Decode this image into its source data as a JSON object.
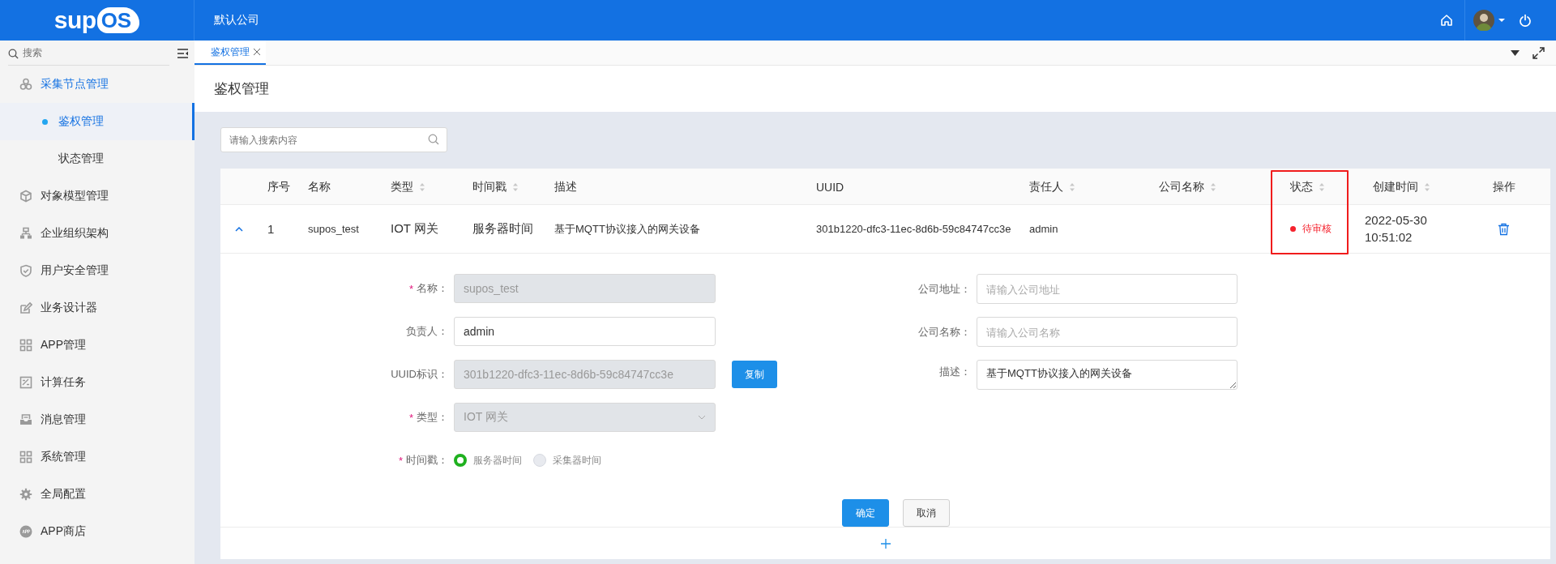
{
  "header": {
    "logo_text": "sup",
    "logo_badge": "OS",
    "company": "默认公司"
  },
  "sidebar": {
    "search_placeholder": "搜索",
    "items": [
      {
        "label": "采集节点管理",
        "selected": false,
        "expanded": true,
        "children": [
          {
            "label": "鉴权管理",
            "selected": true
          },
          {
            "label": "状态管理",
            "selected": false
          }
        ]
      },
      {
        "label": "对象模型管理",
        "selected": false,
        "expanded": false
      },
      {
        "label": "企业组织架构",
        "selected": false,
        "expanded": false
      },
      {
        "label": "用户安全管理",
        "selected": false,
        "expanded": false
      },
      {
        "label": "业务设计器",
        "selected": false,
        "expanded": false
      },
      {
        "label": "APP管理",
        "selected": false,
        "expanded": false
      },
      {
        "label": "计算任务",
        "selected": false,
        "expanded": false
      },
      {
        "label": "消息管理",
        "selected": false,
        "expanded": false
      },
      {
        "label": "系统管理",
        "selected": false,
        "expanded": false
      },
      {
        "label": "全局配置",
        "selected": false,
        "expanded": false
      },
      {
        "label": "APP商店",
        "selected": false,
        "expanded": false
      }
    ]
  },
  "tabs": [
    {
      "label": "鉴权管理",
      "selected": true
    }
  ],
  "page_title": "鉴权管理",
  "search": {
    "placeholder": "请输入搜索内容"
  },
  "table": {
    "columns": [
      {
        "label": "序号",
        "sortable": false,
        "highlighted": false
      },
      {
        "label": "名称",
        "sortable": false,
        "highlighted": false
      },
      {
        "label": "类型",
        "sortable": true,
        "highlighted": false
      },
      {
        "label": "时间戳",
        "sortable": true,
        "highlighted": false
      },
      {
        "label": "描述",
        "sortable": false,
        "highlighted": false
      },
      {
        "label": "UUID",
        "sortable": false,
        "highlighted": false
      },
      {
        "label": "责任人",
        "sortable": true,
        "highlighted": false
      },
      {
        "label": "公司名称",
        "sortable": true,
        "highlighted": false
      },
      {
        "label": "状态",
        "sortable": true,
        "highlighted": true
      },
      {
        "label": "创建时间",
        "sortable": true,
        "highlighted": false
      },
      {
        "label": "操作",
        "sortable": false,
        "highlighted": false
      }
    ],
    "rows": [
      {
        "expanded": true,
        "index": "1",
        "name": "supos_test",
        "type": "IOT 网关",
        "timestamp": "服务器时间",
        "description": "基于MQTT协议接入的网关设备",
        "uuid": "301b1220-dfc3-11ec-8d6b-59c84747cc3e",
        "owner": "admin",
        "status": {
          "label": "待审核",
          "color": "#f5222d"
        },
        "created": "2022-05-30 10:51:02"
      }
    ]
  },
  "form": {
    "left": [
      {
        "kind": "text",
        "label": "名称：",
        "required_mark": "*",
        "disabled": true,
        "value": "supos_test"
      },
      {
        "kind": "text",
        "label": "负责人：",
        "disabled": false,
        "value": "admin"
      },
      {
        "kind": "text",
        "label": "UUID标识：",
        "disabled": true,
        "value": "301b1220-dfc3-11ec-8d6b-59c84747cc3e",
        "action": "复制"
      },
      {
        "kind": "select",
        "label": "类型：",
        "required_mark": "*",
        "disabled": true,
        "value": "IOT 网关"
      },
      {
        "kind": "radio",
        "label": "时间戳：",
        "required_mark": "*",
        "options": [
          {
            "label": "服务器时间",
            "selected": true
          },
          {
            "label": "采集器时间",
            "selected": false
          }
        ]
      }
    ],
    "right": [
      {
        "kind": "text",
        "label": "公司地址：",
        "disabled": false,
        "placeholder": "请输入公司地址"
      },
      {
        "kind": "text",
        "label": "公司名称：",
        "disabled": false,
        "placeholder": "请输入公司名称"
      },
      {
        "kind": "textarea",
        "label": "描述：",
        "disabled": false,
        "value": "基于MQTT协议接入的网关设备"
      }
    ],
    "buttons": [
      {
        "label": "确定",
        "kind": "primary"
      },
      {
        "label": "取消",
        "kind": "default"
      }
    ]
  }
}
